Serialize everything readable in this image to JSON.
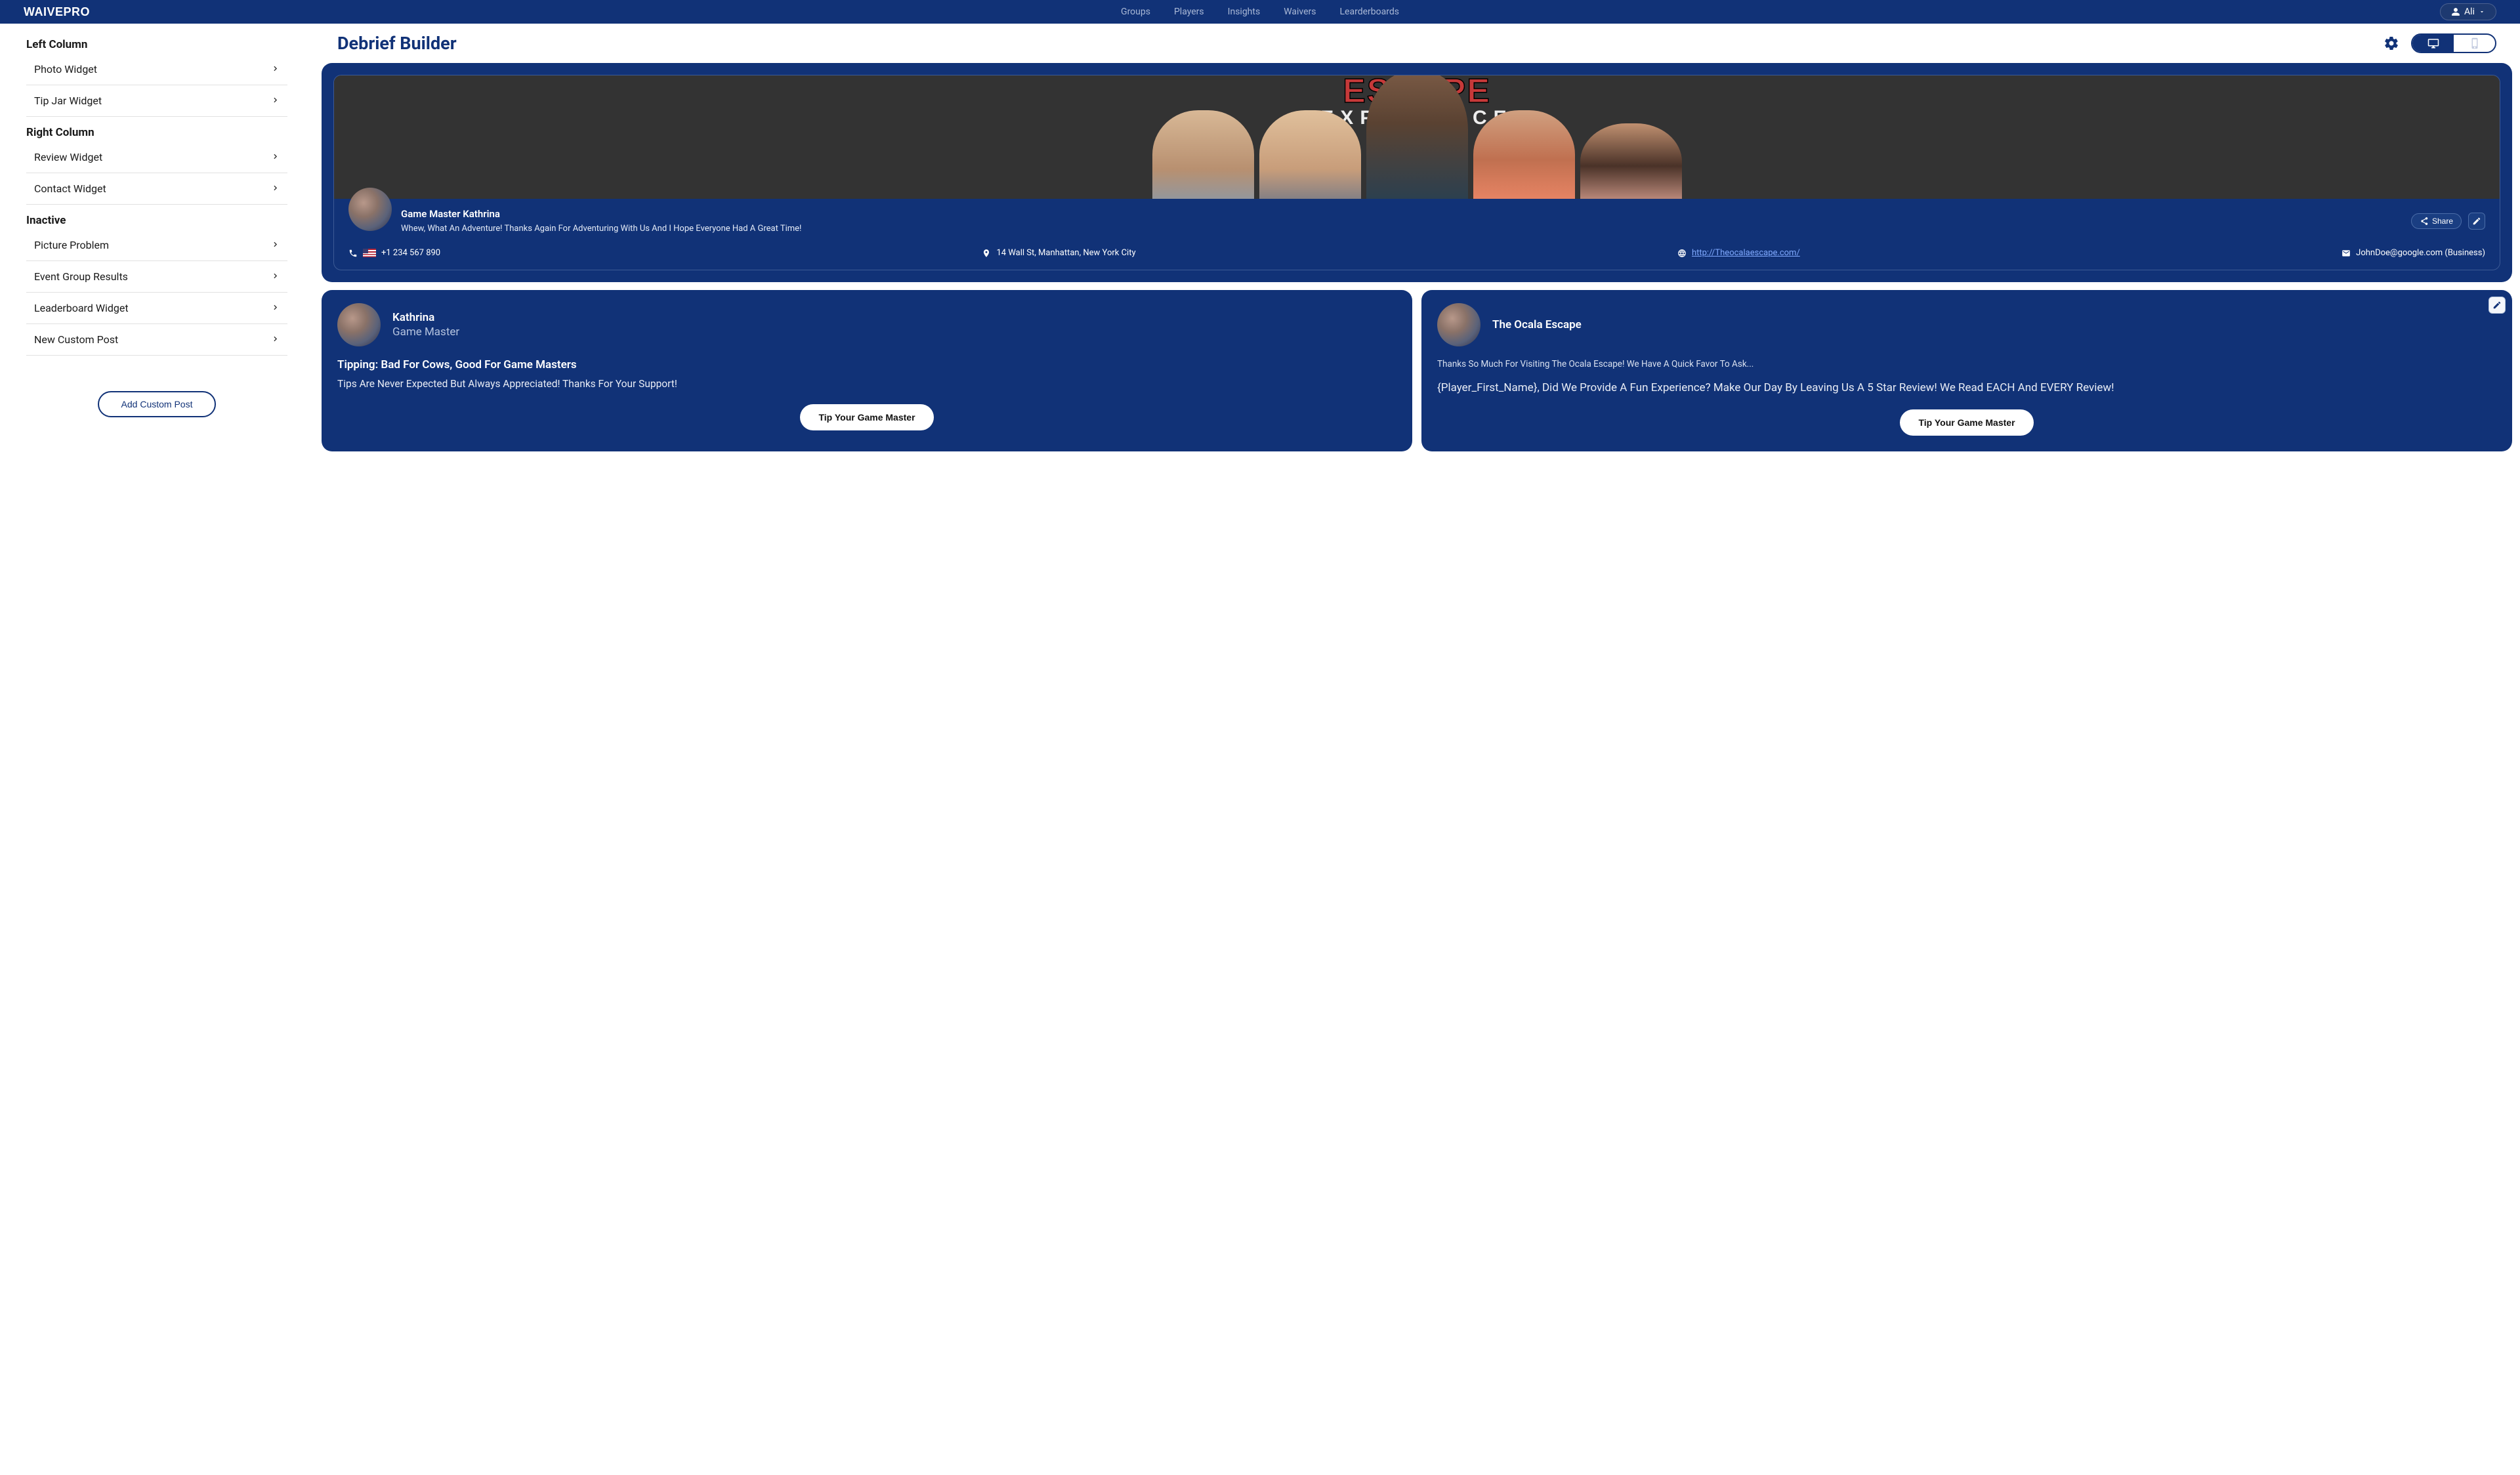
{
  "brand": "WAIVEPRO",
  "nav": {
    "groups": "Groups",
    "players": "Players",
    "insights": "Insights",
    "waivers": "Waivers",
    "leaderboards": "Learderboards"
  },
  "user": {
    "name": "Ali"
  },
  "page_title": "Debrief Builder",
  "sidebar": {
    "sections": [
      {
        "title": "Left Column",
        "items": [
          "Photo Widget",
          "Tip Jar Widget"
        ]
      },
      {
        "title": "Right Column",
        "items": [
          "Review Widget",
          "Contact Widget"
        ]
      },
      {
        "title": "Inactive",
        "items": [
          "Picture Problem",
          "Event Group Results",
          "Leaderboard Widget",
          "New Custom Post"
        ]
      }
    ],
    "add_btn": "Add Custom Post"
  },
  "hero": {
    "name": "Game Master Kathrina",
    "tagline": "Whew, What An Adventure! Thanks Again For Adventuring With Us And I Hope Everyone Had A Great Time!",
    "share": "Share",
    "phone": "+1 234 567 890",
    "address": "14 Wall St, Manhattan, New York City",
    "url": "http://Theocalaescape.com/",
    "email": "JohnDoe@google.com (Business)"
  },
  "cards": [
    {
      "name": "Kathrina",
      "role": "Game Master",
      "title": "Tipping: Bad For Cows, Good For Game Masters",
      "body": "Tips Are Never Expected But Always Appreciated! Thanks For Your Support!",
      "btn": "Tip Your Game Master"
    },
    {
      "name": "The Ocala Escape",
      "sub": "Thanks So Much For Visiting The Ocala Escape! We Have A Quick Favor To Ask...",
      "body": "{Player_First_Name}, Did We Provide A Fun Experience? Make Our Day By Leaving Us A 5 Star Review! We Read EACH And EVERY Review!",
      "btn": "Tip Your Game Master"
    }
  ]
}
